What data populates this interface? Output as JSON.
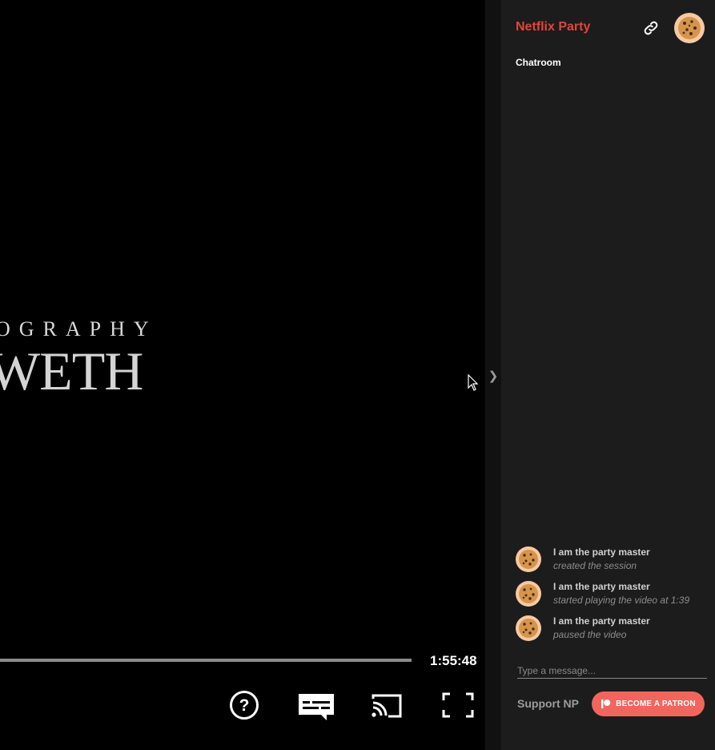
{
  "video": {
    "credit_line1": "OGRAPHY",
    "credit_line2": "WETH",
    "progress_fraction": 1.0,
    "time_remaining": "1:55:48",
    "controls": [
      {
        "name": "help-icon"
      },
      {
        "name": "subtitles-icon"
      },
      {
        "name": "cast-icon"
      },
      {
        "name": "fullscreen-icon"
      }
    ]
  },
  "sidebar_toggle": "❯",
  "panel": {
    "brand": "Netflix Party",
    "chat_title": "Chatroom",
    "messages": [
      {
        "name": "I am the party master",
        "text": "created the session"
      },
      {
        "name": "I am the party master",
        "text": "started playing the video at 1:39"
      },
      {
        "name": "I am the party master",
        "text": "paused the video"
      }
    ],
    "input_placeholder": "Type a message...",
    "support_label": "Support NP",
    "patron_label": "BECOME A PATRON"
  },
  "colors": {
    "brand": "#e2453c",
    "patron": "#f0665d",
    "panel_bg": "#1c1c1c"
  }
}
